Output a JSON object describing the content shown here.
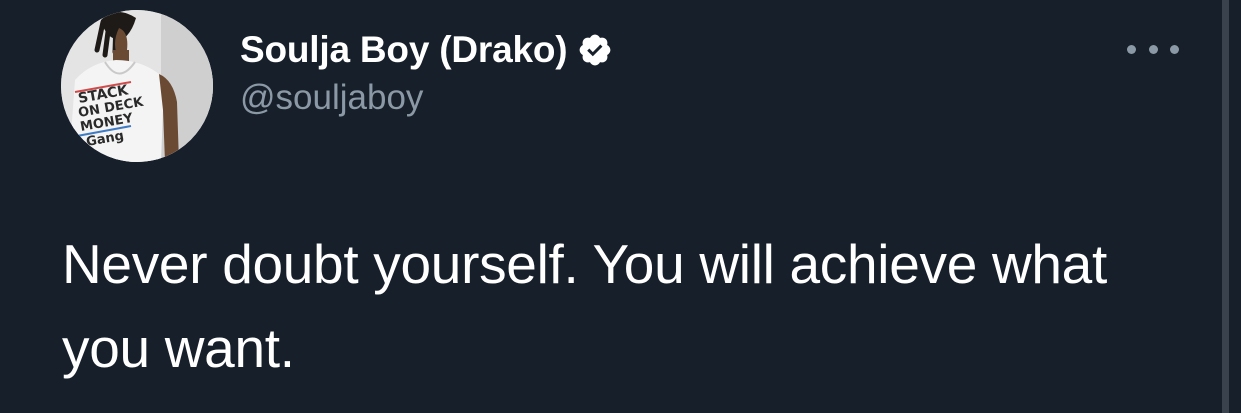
{
  "tweet": {
    "display_name": "Soulja Boy (Drako)",
    "handle": "@souljaboy",
    "verified": true,
    "text": "Never doubt yourself. You will achieve what you want.",
    "avatar": {
      "shirt_text": "STACK ON DECK MONEY Gang"
    },
    "more_icon": "more-horizontal-icon",
    "verified_icon": "verified-badge-icon"
  },
  "colors": {
    "background": "#161f2a",
    "name": "#ffffff",
    "handle": "#8b98a5",
    "text": "#ffffff"
  }
}
